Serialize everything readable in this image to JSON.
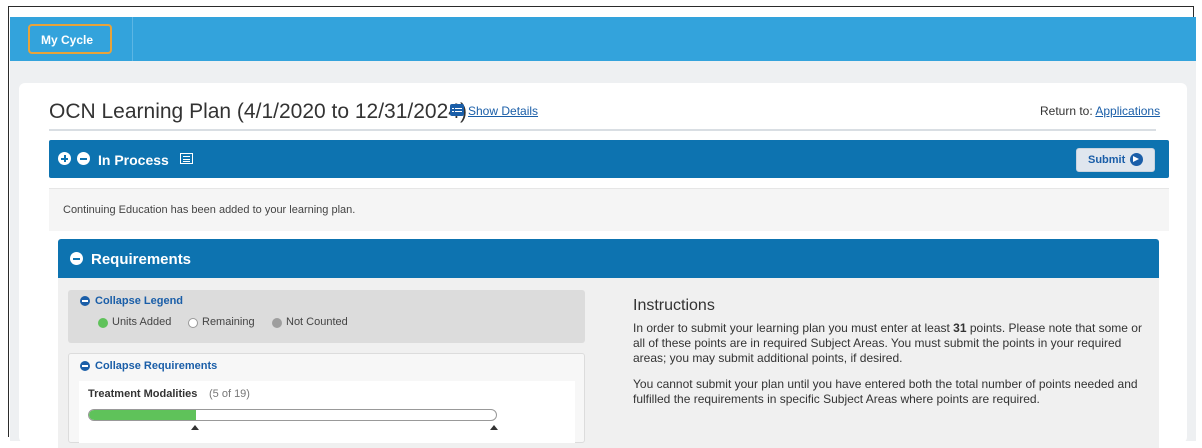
{
  "nav": {
    "tab_label": "My Cycle"
  },
  "header": {
    "title": "OCN Learning Plan (4/1/2020 to 12/31/2024)",
    "show_details": "Show Details",
    "return_prefix": "Return to:",
    "return_link": "Applications"
  },
  "process": {
    "label": "In Process",
    "submit_label": "Submit"
  },
  "notice": {
    "text": "Continuing Education has been added to your learning plan."
  },
  "requirements": {
    "title": "Requirements",
    "legend": {
      "collapse_label": "Collapse Legend",
      "items": [
        "Units Added",
        "Remaining",
        "Not Counted"
      ],
      "colors": [
        "#5fc25a",
        "#ffffff",
        "#9e9e9e"
      ]
    },
    "collapse_requirements_label": "Collapse Requirements",
    "modalities": {
      "label": "Treatment Modalities",
      "count_text": "(5 of 19)",
      "completed": 5,
      "total": 19
    }
  },
  "instructions": {
    "title": "Instructions",
    "p1_before": "In order to submit your learning plan you must enter at least ",
    "p1_points": "31",
    "p1_after": " points. Please note that some or all of these points are in required Subject Areas. You must submit the points in your required areas; you may submit additional points, if desired.",
    "p2": "You cannot submit your plan until you have entered both the total number of points needed and fulfilled the requirements in specific Subject Areas where points are required."
  },
  "colors": {
    "topbar": "#33a3dc",
    "primary_bar": "#0d73b0",
    "link": "#1a5ea8",
    "highlight": "#e8a33a"
  }
}
